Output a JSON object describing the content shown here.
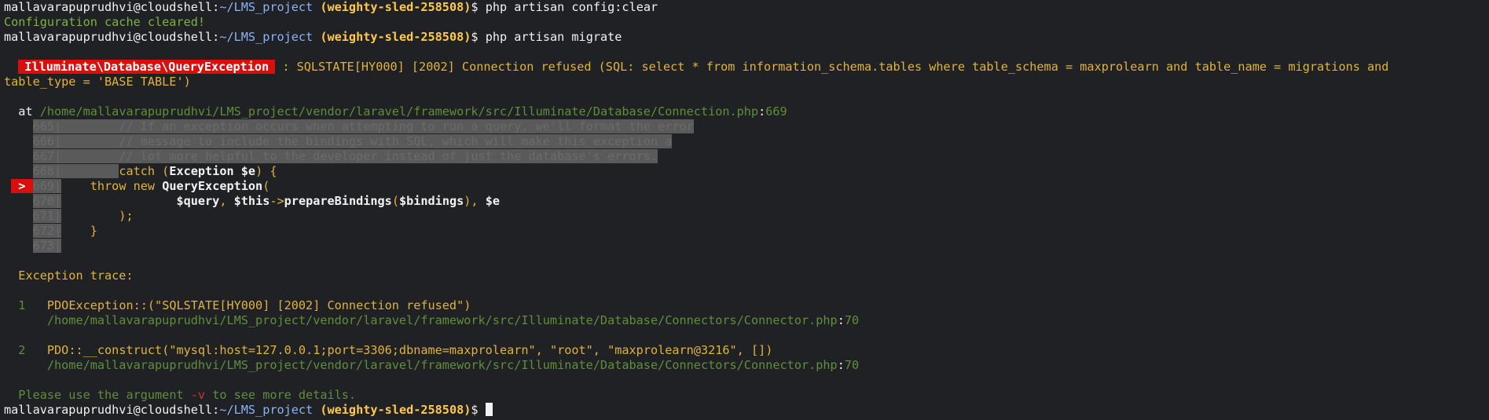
{
  "prompt": {
    "user": "mallavarapuprudhvi@cloudshell",
    "sep": ":",
    "path": "~/LMS_project",
    "project": "(weighty-sled-258508)",
    "dollar": "$"
  },
  "cmd1": " php artisan config:clear",
  "cmd1_output": "Configuration cache cleared!",
  "cmd2": " php artisan migrate",
  "error": {
    "exception_class": "Illuminate\\Database\\QueryException",
    "message_line1": " : SQLSTATE[HY000] [2002] Connection refused (SQL: select * from information_schema.tables where table_schema = maxprolearn and table_name = migrations and",
    "message_line2": "table_type = 'BASE TABLE')",
    "at_label": "at ",
    "at_path": "/home/mallavarapuprudhvi/LMS_project/vendor/laravel/framework/src/Illuminate/Database/Connection.php",
    "at_colon": ":",
    "at_line": "669"
  },
  "code": {
    "l665": "665|",
    "l665_text": "        // If an exception occurs when attempting to run a query, we'll format the error",
    "l666": "666|",
    "l666_text": "        // message to include the bindings with SQL, which will make this exception a",
    "l667": "667|",
    "l667_text": "        // lot more helpful to the developer instead of just the database's errors.",
    "l668": "668|",
    "l668_kw": "catch",
    "l668_rest1": " (",
    "l668_cls": "Exception $e",
    "l668_rest2": ") {",
    "l669_marker": " > ",
    "l669": "669|",
    "l669_kw": "    throw new ",
    "l669_cls": "QueryException",
    "l669_rest": "(",
    "l670": "670|",
    "l670_a": "$query",
    "l670_b": ", ",
    "l670_c": "$this",
    "l670_d": "->",
    "l670_e": "prepareBindings",
    "l670_f": "(",
    "l670_g": "$bindings",
    "l670_h": "), ",
    "l670_i": "$e",
    "l671": "671|",
    "l671_text": "        );",
    "l672": "672|",
    "l672_text": "    }",
    "l673": "673|"
  },
  "trace": {
    "title": "Exception trace:",
    "items": [
      {
        "num": "1",
        "call": "PDOException::(\"SQLSTATE[HY000] [2002] Connection refused\")",
        "file": "/home/mallavarapuprudhvi/LMS_project/vendor/laravel/framework/src/Illuminate/Database/Connectors/Connector.php",
        "colon": ":",
        "line": "70"
      },
      {
        "num": "2",
        "call": "PDO::__construct(\"mysql:host=127.0.0.1;port=3306;dbname=maxprolearn\", \"root\", \"maxprolearn@3216\", [])",
        "file": "/home/mallavarapuprudhvi/LMS_project/vendor/laravel/framework/src/Illuminate/Database/Connectors/Connector.php",
        "colon": ":",
        "line": "70"
      }
    ]
  },
  "hint": {
    "pre": "Please use the argument ",
    "flag": "-v",
    "post": " to see more details."
  },
  "colors": {
    "background": "#202124",
    "error_badge": "#d90f0f",
    "project": "#ffc94d",
    "path": "#8ab4f8",
    "success": "#7cb342"
  }
}
